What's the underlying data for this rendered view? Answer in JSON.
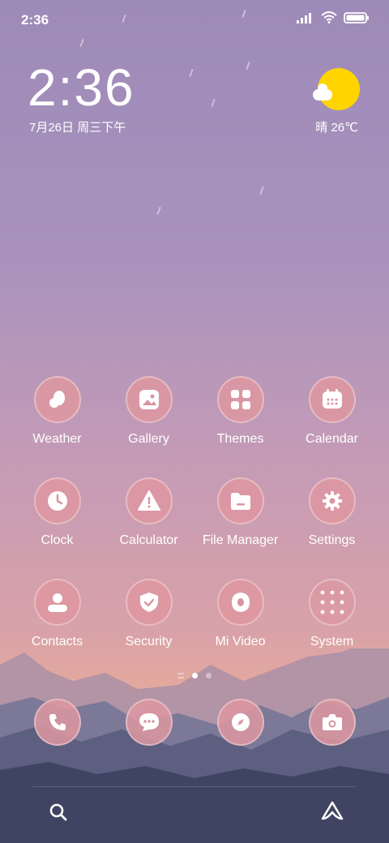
{
  "status_bar": {
    "time": "2:36"
  },
  "clock": {
    "time": "2:36",
    "date": "7月26日 周三下午"
  },
  "weather": {
    "text": "晴 26℃"
  },
  "apps": [
    {
      "label": "Weather",
      "icon": "weather-icon"
    },
    {
      "label": "Gallery",
      "icon": "gallery-icon"
    },
    {
      "label": "Themes",
      "icon": "themes-icon"
    },
    {
      "label": "Calendar",
      "icon": "calendar-icon"
    },
    {
      "label": "Clock",
      "icon": "clock-icon"
    },
    {
      "label": "Calculator",
      "icon": "warning-icon"
    },
    {
      "label": "File Manager",
      "icon": "folder-icon"
    },
    {
      "label": "Settings",
      "icon": "gear-icon"
    },
    {
      "label": "Contacts",
      "icon": "contact-icon"
    },
    {
      "label": "Security",
      "icon": "shield-icon"
    },
    {
      "label": "Mi Video",
      "icon": "video-icon"
    },
    {
      "label": "System",
      "icon": "folder-grid-icon"
    }
  ],
  "dock": [
    {
      "icon": "phone-icon"
    },
    {
      "icon": "messages-icon"
    },
    {
      "icon": "browser-compass-icon"
    },
    {
      "icon": "camera-icon"
    }
  ],
  "page_indicator": {
    "pages": 2,
    "current": 1
  }
}
